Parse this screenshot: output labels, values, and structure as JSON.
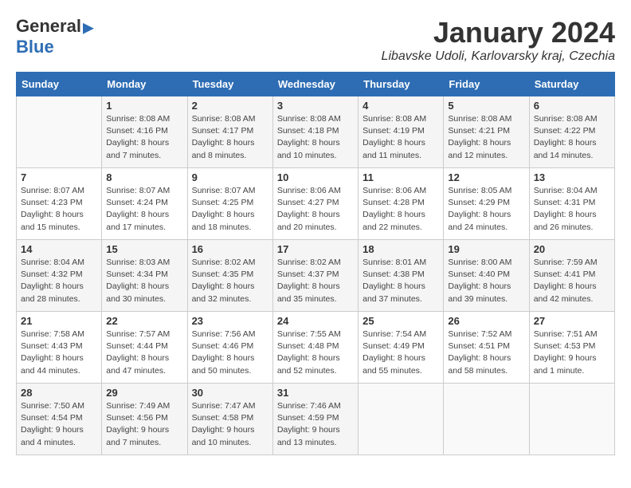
{
  "logo": {
    "general": "General",
    "blue": "Blue"
  },
  "title": "January 2024",
  "location": "Libavske Udoli, Karlovarsky kraj, Czechia",
  "days_header": [
    "Sunday",
    "Monday",
    "Tuesday",
    "Wednesday",
    "Thursday",
    "Friday",
    "Saturday"
  ],
  "weeks": [
    [
      {
        "day": "",
        "sunrise": "",
        "sunset": "",
        "daylight": ""
      },
      {
        "day": "1",
        "sunrise": "Sunrise: 8:08 AM",
        "sunset": "Sunset: 4:16 PM",
        "daylight": "Daylight: 8 hours and 7 minutes."
      },
      {
        "day": "2",
        "sunrise": "Sunrise: 8:08 AM",
        "sunset": "Sunset: 4:17 PM",
        "daylight": "Daylight: 8 hours and 8 minutes."
      },
      {
        "day": "3",
        "sunrise": "Sunrise: 8:08 AM",
        "sunset": "Sunset: 4:18 PM",
        "daylight": "Daylight: 8 hours and 10 minutes."
      },
      {
        "day": "4",
        "sunrise": "Sunrise: 8:08 AM",
        "sunset": "Sunset: 4:19 PM",
        "daylight": "Daylight: 8 hours and 11 minutes."
      },
      {
        "day": "5",
        "sunrise": "Sunrise: 8:08 AM",
        "sunset": "Sunset: 4:21 PM",
        "daylight": "Daylight: 8 hours and 12 minutes."
      },
      {
        "day": "6",
        "sunrise": "Sunrise: 8:08 AM",
        "sunset": "Sunset: 4:22 PM",
        "daylight": "Daylight: 8 hours and 14 minutes."
      }
    ],
    [
      {
        "day": "7",
        "sunrise": "Sunrise: 8:07 AM",
        "sunset": "Sunset: 4:23 PM",
        "daylight": "Daylight: 8 hours and 15 minutes."
      },
      {
        "day": "8",
        "sunrise": "Sunrise: 8:07 AM",
        "sunset": "Sunset: 4:24 PM",
        "daylight": "Daylight: 8 hours and 17 minutes."
      },
      {
        "day": "9",
        "sunrise": "Sunrise: 8:07 AM",
        "sunset": "Sunset: 4:25 PM",
        "daylight": "Daylight: 8 hours and 18 minutes."
      },
      {
        "day": "10",
        "sunrise": "Sunrise: 8:06 AM",
        "sunset": "Sunset: 4:27 PM",
        "daylight": "Daylight: 8 hours and 20 minutes."
      },
      {
        "day": "11",
        "sunrise": "Sunrise: 8:06 AM",
        "sunset": "Sunset: 4:28 PM",
        "daylight": "Daylight: 8 hours and 22 minutes."
      },
      {
        "day": "12",
        "sunrise": "Sunrise: 8:05 AM",
        "sunset": "Sunset: 4:29 PM",
        "daylight": "Daylight: 8 hours and 24 minutes."
      },
      {
        "day": "13",
        "sunrise": "Sunrise: 8:04 AM",
        "sunset": "Sunset: 4:31 PM",
        "daylight": "Daylight: 8 hours and 26 minutes."
      }
    ],
    [
      {
        "day": "14",
        "sunrise": "Sunrise: 8:04 AM",
        "sunset": "Sunset: 4:32 PM",
        "daylight": "Daylight: 8 hours and 28 minutes."
      },
      {
        "day": "15",
        "sunrise": "Sunrise: 8:03 AM",
        "sunset": "Sunset: 4:34 PM",
        "daylight": "Daylight: 8 hours and 30 minutes."
      },
      {
        "day": "16",
        "sunrise": "Sunrise: 8:02 AM",
        "sunset": "Sunset: 4:35 PM",
        "daylight": "Daylight: 8 hours and 32 minutes."
      },
      {
        "day": "17",
        "sunrise": "Sunrise: 8:02 AM",
        "sunset": "Sunset: 4:37 PM",
        "daylight": "Daylight: 8 hours and 35 minutes."
      },
      {
        "day": "18",
        "sunrise": "Sunrise: 8:01 AM",
        "sunset": "Sunset: 4:38 PM",
        "daylight": "Daylight: 8 hours and 37 minutes."
      },
      {
        "day": "19",
        "sunrise": "Sunrise: 8:00 AM",
        "sunset": "Sunset: 4:40 PM",
        "daylight": "Daylight: 8 hours and 39 minutes."
      },
      {
        "day": "20",
        "sunrise": "Sunrise: 7:59 AM",
        "sunset": "Sunset: 4:41 PM",
        "daylight": "Daylight: 8 hours and 42 minutes."
      }
    ],
    [
      {
        "day": "21",
        "sunrise": "Sunrise: 7:58 AM",
        "sunset": "Sunset: 4:43 PM",
        "daylight": "Daylight: 8 hours and 44 minutes."
      },
      {
        "day": "22",
        "sunrise": "Sunrise: 7:57 AM",
        "sunset": "Sunset: 4:44 PM",
        "daylight": "Daylight: 8 hours and 47 minutes."
      },
      {
        "day": "23",
        "sunrise": "Sunrise: 7:56 AM",
        "sunset": "Sunset: 4:46 PM",
        "daylight": "Daylight: 8 hours and 50 minutes."
      },
      {
        "day": "24",
        "sunrise": "Sunrise: 7:55 AM",
        "sunset": "Sunset: 4:48 PM",
        "daylight": "Daylight: 8 hours and 52 minutes."
      },
      {
        "day": "25",
        "sunrise": "Sunrise: 7:54 AM",
        "sunset": "Sunset: 4:49 PM",
        "daylight": "Daylight: 8 hours and 55 minutes."
      },
      {
        "day": "26",
        "sunrise": "Sunrise: 7:52 AM",
        "sunset": "Sunset: 4:51 PM",
        "daylight": "Daylight: 8 hours and 58 minutes."
      },
      {
        "day": "27",
        "sunrise": "Sunrise: 7:51 AM",
        "sunset": "Sunset: 4:53 PM",
        "daylight": "Daylight: 9 hours and 1 minute."
      }
    ],
    [
      {
        "day": "28",
        "sunrise": "Sunrise: 7:50 AM",
        "sunset": "Sunset: 4:54 PM",
        "daylight": "Daylight: 9 hours and 4 minutes."
      },
      {
        "day": "29",
        "sunrise": "Sunrise: 7:49 AM",
        "sunset": "Sunset: 4:56 PM",
        "daylight": "Daylight: 9 hours and 7 minutes."
      },
      {
        "day": "30",
        "sunrise": "Sunrise: 7:47 AM",
        "sunset": "Sunset: 4:58 PM",
        "daylight": "Daylight: 9 hours and 10 minutes."
      },
      {
        "day": "31",
        "sunrise": "Sunrise: 7:46 AM",
        "sunset": "Sunset: 4:59 PM",
        "daylight": "Daylight: 9 hours and 13 minutes."
      },
      {
        "day": "",
        "sunrise": "",
        "sunset": "",
        "daylight": ""
      },
      {
        "day": "",
        "sunrise": "",
        "sunset": "",
        "daylight": ""
      },
      {
        "day": "",
        "sunrise": "",
        "sunset": "",
        "daylight": ""
      }
    ]
  ]
}
